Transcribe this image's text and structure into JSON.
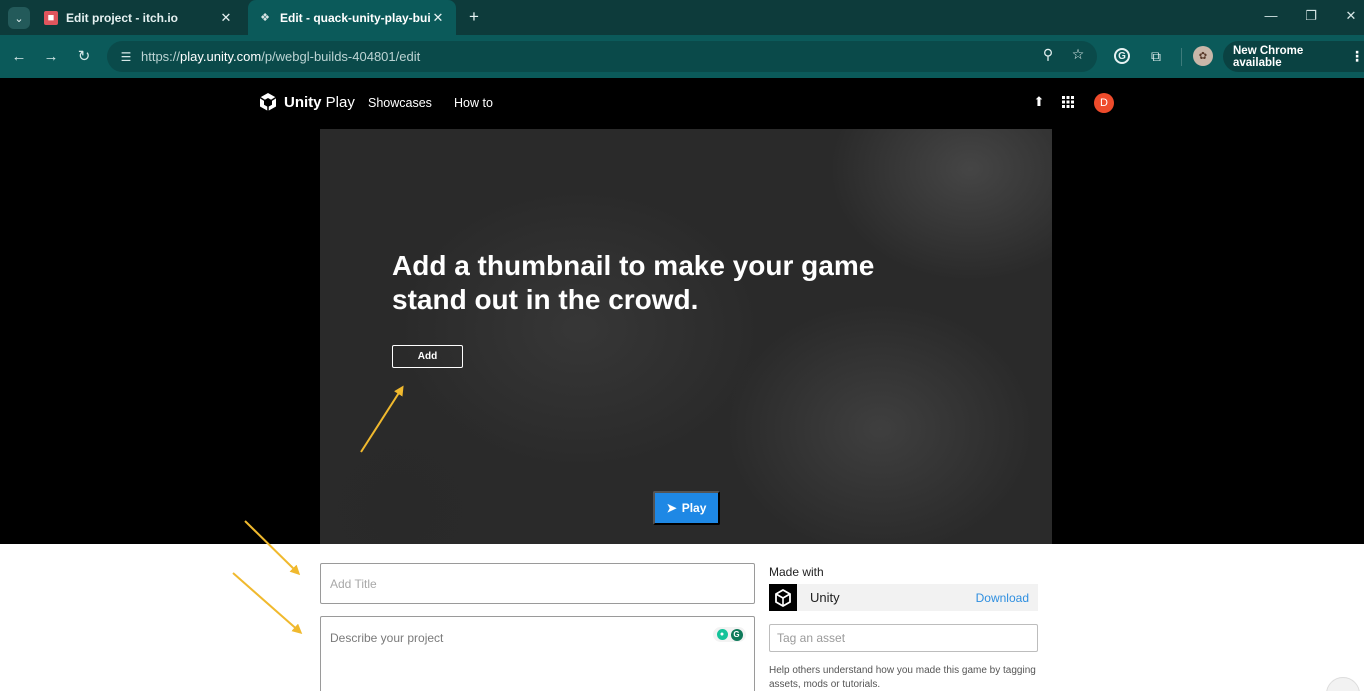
{
  "browser": {
    "tabs": [
      {
        "title": "Edit project - itch.io",
        "favicon": "itch-icon"
      },
      {
        "title": "Edit - quack-unity-play-build",
        "favicon": "unity-icon"
      }
    ],
    "url_prefix": "https://",
    "url_host": "play.unity.com",
    "url_path": "/p/webgl-builds-404801/edit",
    "update_label": "New Chrome available",
    "theme_color": "#0b5a5a"
  },
  "site": {
    "brand_bold": "Unity",
    "brand_light": "Play",
    "nav": [
      "Showcases",
      "How to"
    ],
    "avatar_letter": "D",
    "avatar_color": "#ee4b2b"
  },
  "hero": {
    "title": "Add a thumbnail to make your game stand out in the crowd.",
    "add_label": "Add",
    "play_label": "Play",
    "play_color": "#1e88e5"
  },
  "form": {
    "title_placeholder": "Add Title",
    "description_placeholder": "Describe your project",
    "made_with_label": "Made with",
    "engine_name": "Unity",
    "download_label": "Download",
    "tag_placeholder": "Tag an asset",
    "help_text": "Help others understand how you made this game by tagging assets, mods or tutorials."
  }
}
